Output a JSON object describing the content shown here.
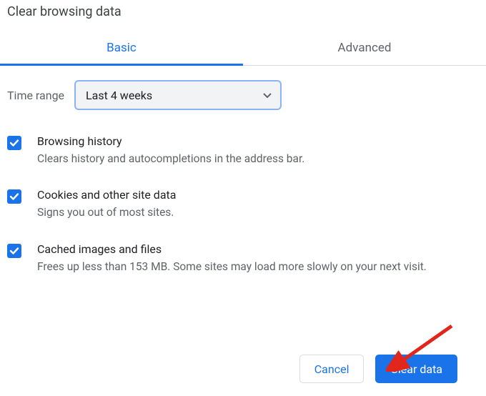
{
  "title": "Clear browsing data",
  "tabs": {
    "basic": "Basic",
    "advanced": "Advanced"
  },
  "time": {
    "label": "Time range",
    "value": "Last 4 weeks"
  },
  "options": [
    {
      "title": "Browsing history",
      "desc": "Clears history and autocompletions in the address bar."
    },
    {
      "title": "Cookies and other site data",
      "desc": "Signs you out of most sites."
    },
    {
      "title": "Cached images and files",
      "desc": "Frees up less than 153 MB. Some sites may load more slowly on your next visit."
    }
  ],
  "buttons": {
    "cancel": "Cancel",
    "clear": "Clear data"
  }
}
